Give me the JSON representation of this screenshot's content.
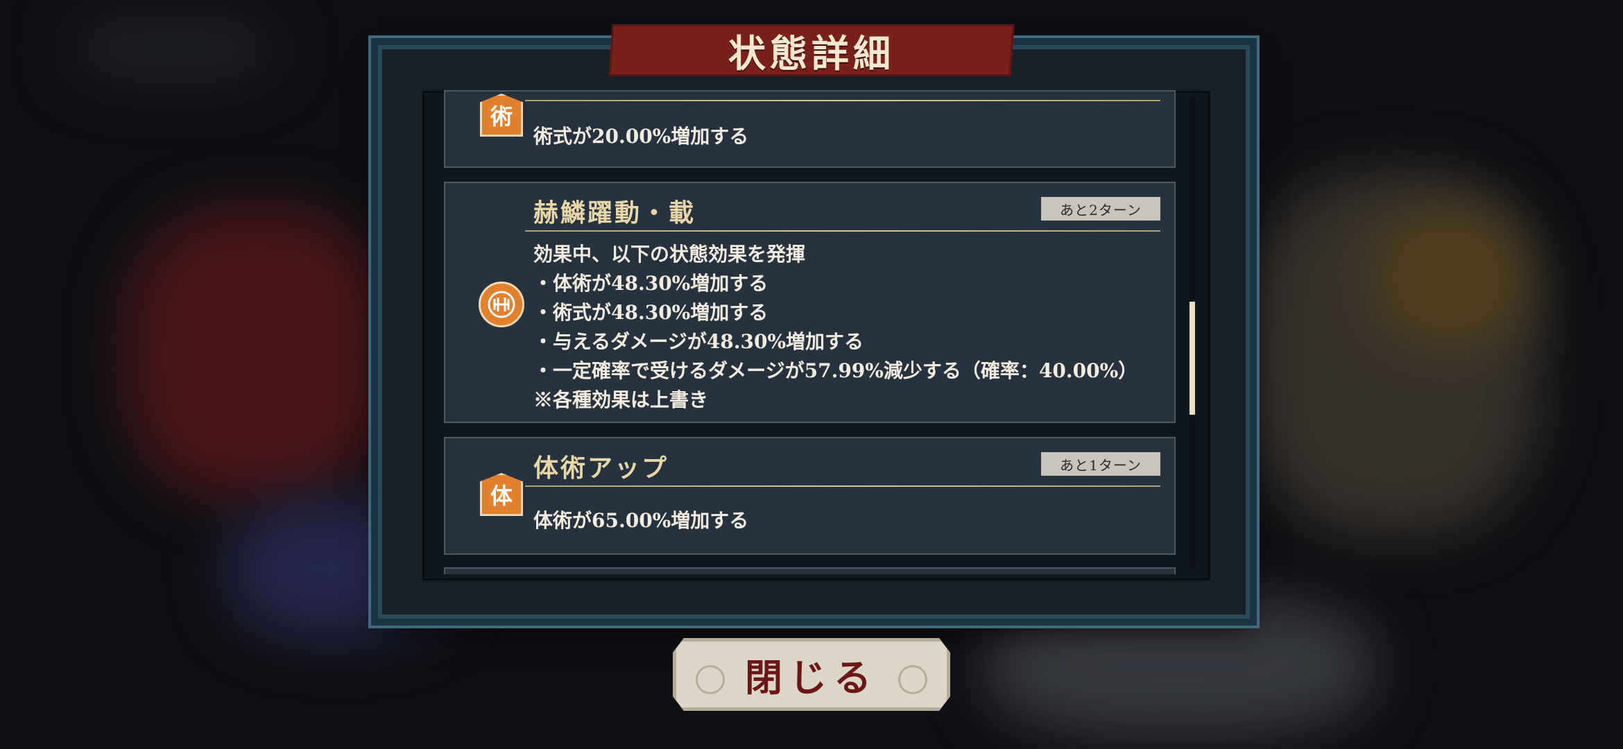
{
  "title": "状態詳細",
  "close_label": "閉じる",
  "cards": [
    {
      "icon": "jutsu-icon",
      "icon_char": "術",
      "body": [
        "術式が20.00%増加する"
      ]
    },
    {
      "icon": "tai-jutsu-emblem-icon",
      "name": "赫鱗躍動・載",
      "turns": "あと2ターン",
      "body": [
        "効果中、以下の状態効果を発揮",
        "・体術が48.30%増加する",
        "・術式が48.30%増加する",
        "・与えるダメージが48.30%増加する",
        "・一定確率で受けるダメージが57.99%減少する（確率：40.00%）",
        "※各種効果は上書き"
      ]
    },
    {
      "icon": "tai-icon",
      "icon_char": "体",
      "name": "体術アップ",
      "turns": "あと1ターン",
      "body": [
        "体術が65.00%増加する"
      ]
    }
  ],
  "colors": {
    "accent": "#e2802e",
    "title_banner": "#7a201c",
    "gold_rule": "#d8c79e"
  }
}
